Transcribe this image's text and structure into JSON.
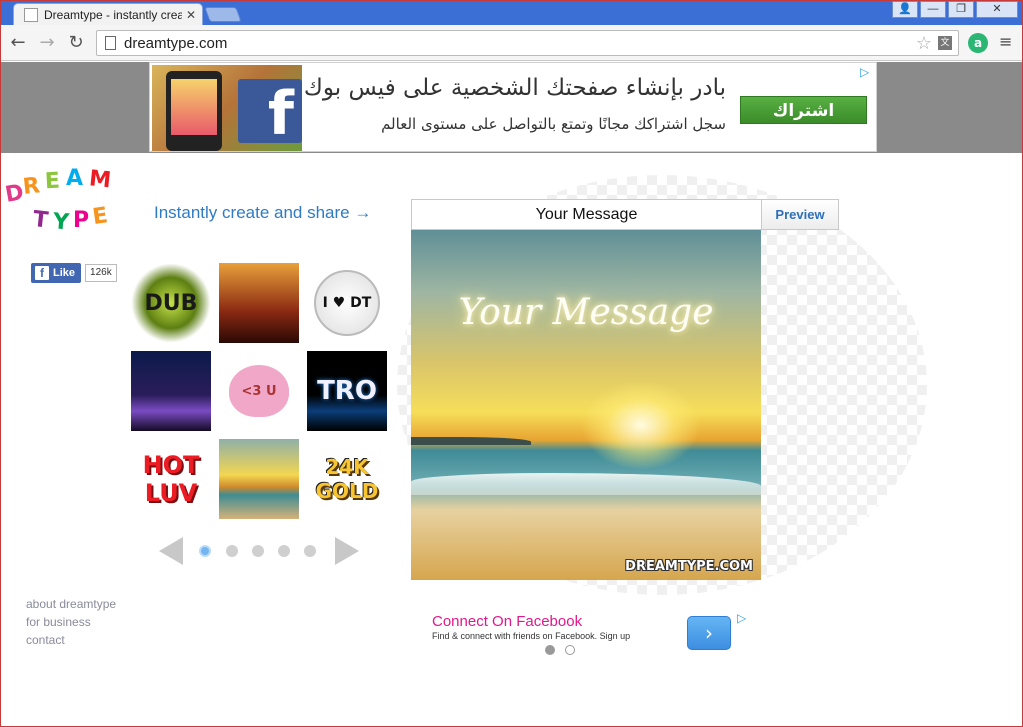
{
  "browser": {
    "tab_title": "Dreamtype - instantly crea",
    "tab_close": "✕",
    "url": "dreamtype.com",
    "win_user": "👤",
    "win_min": "—",
    "win_max": "❐",
    "win_close": "✕"
  },
  "ad_top": {
    "headline": "بادر بإنشاء صفحتك الشخصية على فيس بوك",
    "subline": "سجل اشتراكك مجانًا وتمتع بالتواصل على مستوى العالم",
    "cta": "اشتراك",
    "fb_letter": "f",
    "choices_icon": "▷"
  },
  "page": {
    "logo_text": "DREAM TYPE",
    "tagline": "Instantly create and share →",
    "like_label": "Like",
    "like_count": "126k",
    "thumbs": [
      {
        "label": "DUB"
      },
      {
        "label": ""
      },
      {
        "label": "I ♥ DT"
      },
      {
        "label": ""
      },
      {
        "label": "<3 U"
      },
      {
        "label": "TRO"
      },
      {
        "label": "HOT LUV"
      },
      {
        "label": ""
      },
      {
        "label": "24K GOLD"
      }
    ],
    "footer_links": [
      "about dreamtype",
      "for business",
      "contact"
    ]
  },
  "editor": {
    "message": "Your Message",
    "preview_label": "Preview",
    "canvas_text": "Your Message",
    "watermark": "DREAMTYPE.COM"
  },
  "ad_bottom": {
    "title": "Connect On Facebook",
    "text": "Find & connect with friends on Facebook. Sign up",
    "button_icon": "›",
    "choices_icon": "▷"
  },
  "colors": {
    "accent": "#2e7bc4",
    "ad_title": "#e0198a",
    "facebook": "#3b5998"
  }
}
